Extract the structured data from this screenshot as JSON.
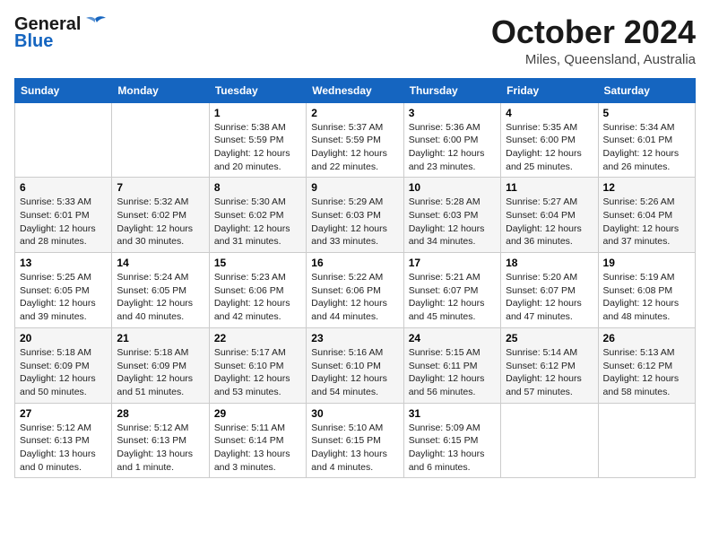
{
  "header": {
    "logo_general": "General",
    "logo_blue": "Blue",
    "month": "October 2024",
    "location": "Miles, Queensland, Australia"
  },
  "days_of_week": [
    "Sunday",
    "Monday",
    "Tuesday",
    "Wednesday",
    "Thursday",
    "Friday",
    "Saturday"
  ],
  "weeks": [
    [
      {
        "day": "",
        "info": ""
      },
      {
        "day": "",
        "info": ""
      },
      {
        "day": "1",
        "info": "Sunrise: 5:38 AM\nSunset: 5:59 PM\nDaylight: 12 hours and 20 minutes."
      },
      {
        "day": "2",
        "info": "Sunrise: 5:37 AM\nSunset: 5:59 PM\nDaylight: 12 hours and 22 minutes."
      },
      {
        "day": "3",
        "info": "Sunrise: 5:36 AM\nSunset: 6:00 PM\nDaylight: 12 hours and 23 minutes."
      },
      {
        "day": "4",
        "info": "Sunrise: 5:35 AM\nSunset: 6:00 PM\nDaylight: 12 hours and 25 minutes."
      },
      {
        "day": "5",
        "info": "Sunrise: 5:34 AM\nSunset: 6:01 PM\nDaylight: 12 hours and 26 minutes."
      }
    ],
    [
      {
        "day": "6",
        "info": "Sunrise: 5:33 AM\nSunset: 6:01 PM\nDaylight: 12 hours and 28 minutes."
      },
      {
        "day": "7",
        "info": "Sunrise: 5:32 AM\nSunset: 6:02 PM\nDaylight: 12 hours and 30 minutes."
      },
      {
        "day": "8",
        "info": "Sunrise: 5:30 AM\nSunset: 6:02 PM\nDaylight: 12 hours and 31 minutes."
      },
      {
        "day": "9",
        "info": "Sunrise: 5:29 AM\nSunset: 6:03 PM\nDaylight: 12 hours and 33 minutes."
      },
      {
        "day": "10",
        "info": "Sunrise: 5:28 AM\nSunset: 6:03 PM\nDaylight: 12 hours and 34 minutes."
      },
      {
        "day": "11",
        "info": "Sunrise: 5:27 AM\nSunset: 6:04 PM\nDaylight: 12 hours and 36 minutes."
      },
      {
        "day": "12",
        "info": "Sunrise: 5:26 AM\nSunset: 6:04 PM\nDaylight: 12 hours and 37 minutes."
      }
    ],
    [
      {
        "day": "13",
        "info": "Sunrise: 5:25 AM\nSunset: 6:05 PM\nDaylight: 12 hours and 39 minutes."
      },
      {
        "day": "14",
        "info": "Sunrise: 5:24 AM\nSunset: 6:05 PM\nDaylight: 12 hours and 40 minutes."
      },
      {
        "day": "15",
        "info": "Sunrise: 5:23 AM\nSunset: 6:06 PM\nDaylight: 12 hours and 42 minutes."
      },
      {
        "day": "16",
        "info": "Sunrise: 5:22 AM\nSunset: 6:06 PM\nDaylight: 12 hours and 44 minutes."
      },
      {
        "day": "17",
        "info": "Sunrise: 5:21 AM\nSunset: 6:07 PM\nDaylight: 12 hours and 45 minutes."
      },
      {
        "day": "18",
        "info": "Sunrise: 5:20 AM\nSunset: 6:07 PM\nDaylight: 12 hours and 47 minutes."
      },
      {
        "day": "19",
        "info": "Sunrise: 5:19 AM\nSunset: 6:08 PM\nDaylight: 12 hours and 48 minutes."
      }
    ],
    [
      {
        "day": "20",
        "info": "Sunrise: 5:18 AM\nSunset: 6:09 PM\nDaylight: 12 hours and 50 minutes."
      },
      {
        "day": "21",
        "info": "Sunrise: 5:18 AM\nSunset: 6:09 PM\nDaylight: 12 hours and 51 minutes."
      },
      {
        "day": "22",
        "info": "Sunrise: 5:17 AM\nSunset: 6:10 PM\nDaylight: 12 hours and 53 minutes."
      },
      {
        "day": "23",
        "info": "Sunrise: 5:16 AM\nSunset: 6:10 PM\nDaylight: 12 hours and 54 minutes."
      },
      {
        "day": "24",
        "info": "Sunrise: 5:15 AM\nSunset: 6:11 PM\nDaylight: 12 hours and 56 minutes."
      },
      {
        "day": "25",
        "info": "Sunrise: 5:14 AM\nSunset: 6:12 PM\nDaylight: 12 hours and 57 minutes."
      },
      {
        "day": "26",
        "info": "Sunrise: 5:13 AM\nSunset: 6:12 PM\nDaylight: 12 hours and 58 minutes."
      }
    ],
    [
      {
        "day": "27",
        "info": "Sunrise: 5:12 AM\nSunset: 6:13 PM\nDaylight: 13 hours and 0 minutes."
      },
      {
        "day": "28",
        "info": "Sunrise: 5:12 AM\nSunset: 6:13 PM\nDaylight: 13 hours and 1 minute."
      },
      {
        "day": "29",
        "info": "Sunrise: 5:11 AM\nSunset: 6:14 PM\nDaylight: 13 hours and 3 minutes."
      },
      {
        "day": "30",
        "info": "Sunrise: 5:10 AM\nSunset: 6:15 PM\nDaylight: 13 hours and 4 minutes."
      },
      {
        "day": "31",
        "info": "Sunrise: 5:09 AM\nSunset: 6:15 PM\nDaylight: 13 hours and 6 minutes."
      },
      {
        "day": "",
        "info": ""
      },
      {
        "day": "",
        "info": ""
      }
    ]
  ]
}
